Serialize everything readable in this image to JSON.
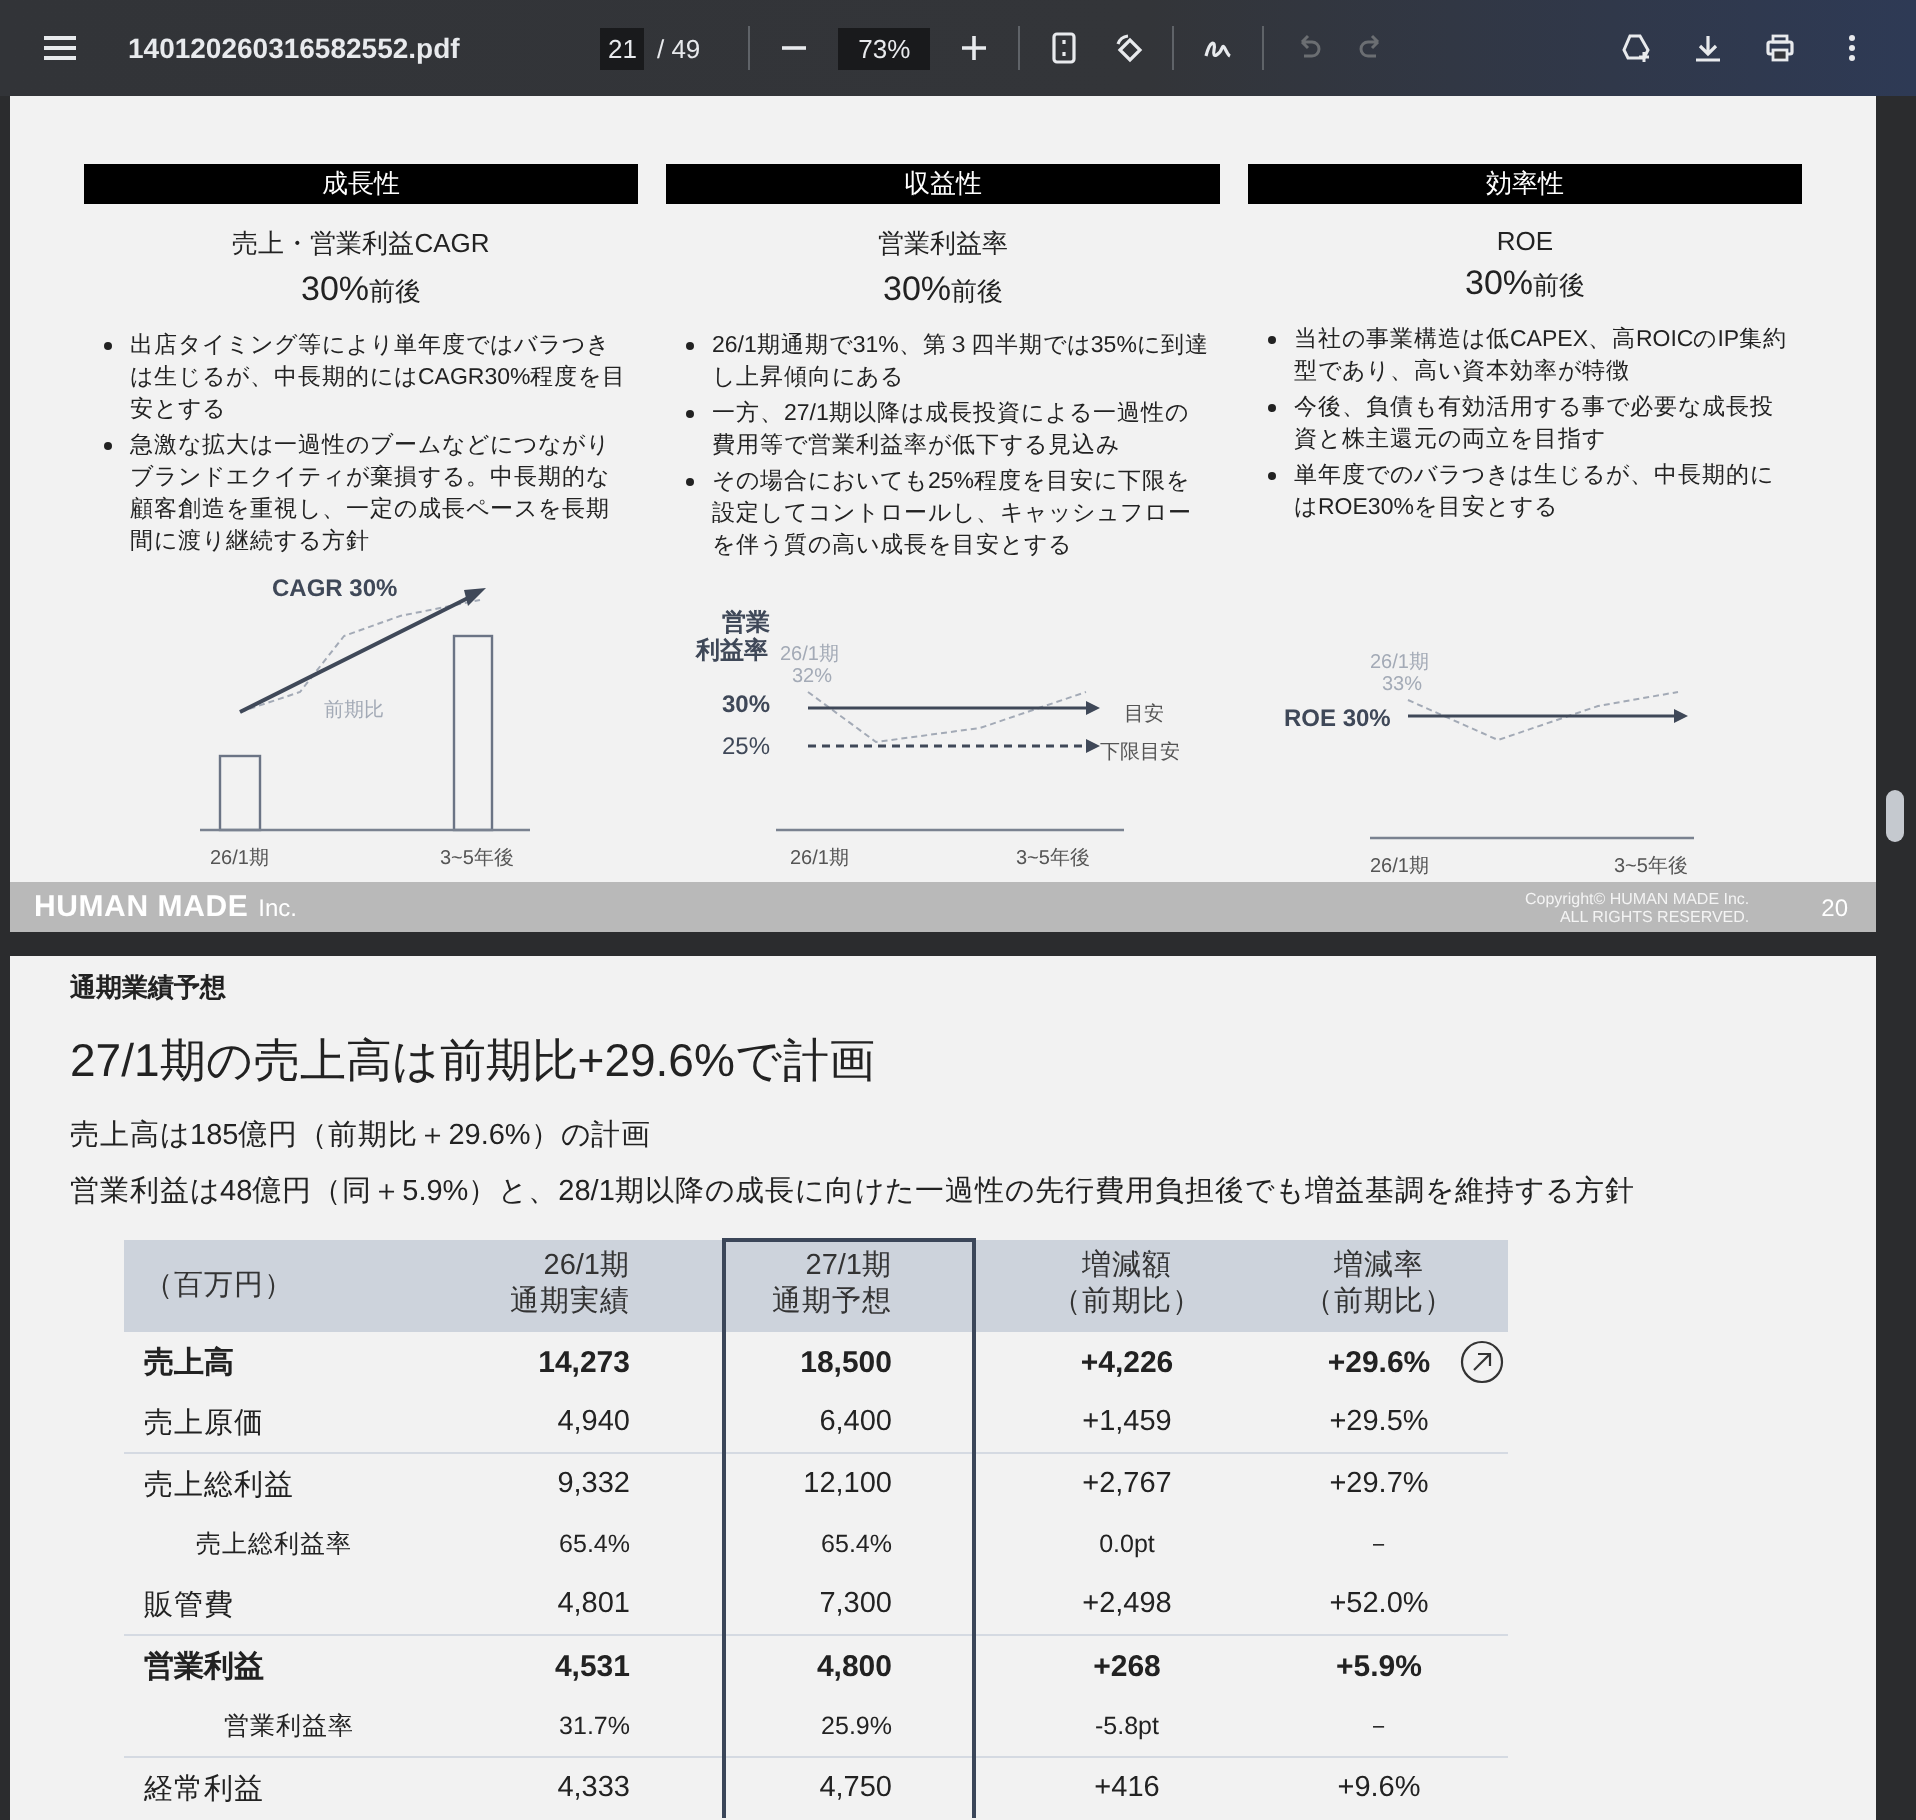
{
  "toolbar": {
    "filename": "140120260316582552.pdf",
    "page_input": "21",
    "page_total": "/ 49",
    "zoom": "73%",
    "tools": [
      {
        "kind": "fit",
        "disabled": false
      },
      {
        "kind": "rotate",
        "disabled": false
      },
      {
        "kind": "draw",
        "disabled": false
      },
      {
        "kind": "undo",
        "disabled": true
      },
      {
        "kind": "redo",
        "disabled": true
      }
    ],
    "actions": [
      {
        "kind": "drive"
      },
      {
        "kind": "download"
      },
      {
        "kind": "print"
      },
      {
        "kind": "more"
      }
    ]
  },
  "slide": {
    "columns": [
      {
        "header": "成長性",
        "subtitle": "売上・営業利益CAGR",
        "target": "30%",
        "target_suffix": "前後",
        "bullets": [
          "出店タイミング等により単年度ではバラつきは生じるが、中長期的にはCAGR30%程度を目安とする",
          "急激な拡大は一過性のブームなどにつながりブランドエクイティが棄損する。中長期的な顧客創造を重視し、一定の成長ペースを長期間に渡り継続する方針"
        ],
        "drawing": {
          "kind": "cagr",
          "title": "CAGR 30%",
          "trend_label": "前期比",
          "x_labels": [
            "26/1期",
            "3~5年後"
          ]
        }
      },
      {
        "header": "収益性",
        "subtitle": "営業利益率",
        "target": "30%",
        "target_suffix": "前後",
        "bullets": [
          "26/1期通期で31%、第３四半期では35%に到達し上昇傾向にある",
          "一方、27/1期以降は成長投資による一過性の費用等で営業利益率が低下する見込み",
          "その場合においても25%程度を目安に下限を設定してコントロールし、キャッシュフローを伴う質の高い成長を目安とする"
        ],
        "drawing": {
          "kind": "margin",
          "axis_label": [
            "営業",
            "利益率"
          ],
          "point_label": "26/1期",
          "point_value": "32%",
          "line_labels": [
            "30%",
            "25%"
          ],
          "line_notes": [
            "目安",
            "下限目安"
          ],
          "x_labels": [
            "26/1期",
            "3~5年後"
          ]
        }
      },
      {
        "header": "効率性",
        "subtitle": "ROE",
        "target": "30%",
        "target_suffix": "前後",
        "bullets": [
          "当社の事業構造は低CAPEX、高ROICのIP集約型であり、高い資本効率が特徴",
          "今後、負債も有効活用する事で必要な成長投資と株主還元の両立を目指す",
          "単年度でのバラつきは生じるが、中長期的にはROE30%を目安とする"
        ],
        "drawing": {
          "kind": "roe",
          "point_label": "26/1期",
          "point_value": "33%",
          "line_label": "ROE 30%",
          "x_labels": [
            "26/1期",
            "3~5年後"
          ]
        }
      }
    ],
    "footer": {
      "logo": "HUMAN MADE",
      "logo_suffix": "Inc.",
      "copyright": [
        "Copyright© HUMAN MADE Inc.",
        "ALL RIGHTS RESERVED."
      ],
      "page_number": "20"
    }
  },
  "page": {
    "section": "通期業績予想",
    "heading": "27/1期の売上高は前期比+29.6%で計画",
    "lines": [
      "売上高は185億円（前期比＋29.6%）の計画",
      "営業利益は48億円（同＋5.9%）と、28/1期以降の成長に向けた一過性の先行費用負担後でも増益基調を維持する方針"
    ],
    "table": {
      "header_rows": [
        [
          {
            "text": "（百万円）",
            "rowspan": 2
          },
          "26/1期",
          "27/1期",
          "増減額",
          "増減率"
        ],
        [
          "通期実績",
          "通期予想",
          "（前期比）",
          "（前期比）"
        ]
      ],
      "rows": [
        {
          "kind": "bold",
          "divider": false,
          "cells": [
            "売上高",
            "14,273",
            "18,500",
            "+4,226",
            "+29.6%"
          ],
          "link": true
        },
        {
          "kind": "normal",
          "divider": false,
          "cells": [
            "売上原価",
            "4,940",
            "6,400",
            "+1,459",
            "+29.5%"
          ],
          "link": false
        },
        {
          "kind": "normal",
          "divider": true,
          "cells": [
            "売上総利益",
            "9,332",
            "12,100",
            "+2,767",
            "+29.7%"
          ],
          "link": false
        },
        {
          "kind": "sub",
          "divider": false,
          "cells": [
            "売上総利益率",
            "65.4%",
            "65.4%",
            "0.0pt",
            "－"
          ],
          "link": false
        },
        {
          "kind": "normal",
          "divider": false,
          "cells": [
            "販管費",
            "4,801",
            "7,300",
            "+2,498",
            "+52.0%"
          ],
          "link": false
        },
        {
          "kind": "bold",
          "divider": true,
          "cells": [
            "営業利益",
            "4,531",
            "4,800",
            "+268",
            "+5.9%"
          ],
          "link": false
        },
        {
          "kind": "sub2",
          "divider": false,
          "cells": [
            "営業利益率",
            "31.7%",
            "25.9%",
            "-5.8pt",
            "－"
          ],
          "link": false
        },
        {
          "kind": "normal",
          "divider": true,
          "cells": [
            "経常利益",
            "4,333",
            "4,750",
            "+416",
            "+9.6%"
          ],
          "link": false
        }
      ]
    }
  }
}
